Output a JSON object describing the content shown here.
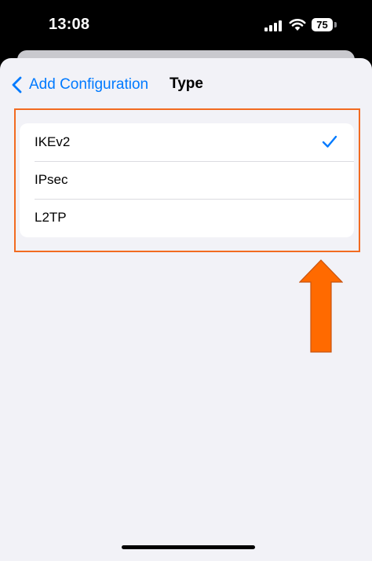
{
  "status_bar": {
    "time": "13:08",
    "battery": "75"
  },
  "nav": {
    "back_label": "Add Configuration",
    "title": "Type"
  },
  "types": [
    {
      "label": "IKEv2",
      "selected": true
    },
    {
      "label": "IPsec",
      "selected": false
    },
    {
      "label": "L2TP",
      "selected": false
    }
  ],
  "colors": {
    "accent": "#007aff",
    "annotation": "#f26b21",
    "arrow_fill": "#ff6a00"
  }
}
